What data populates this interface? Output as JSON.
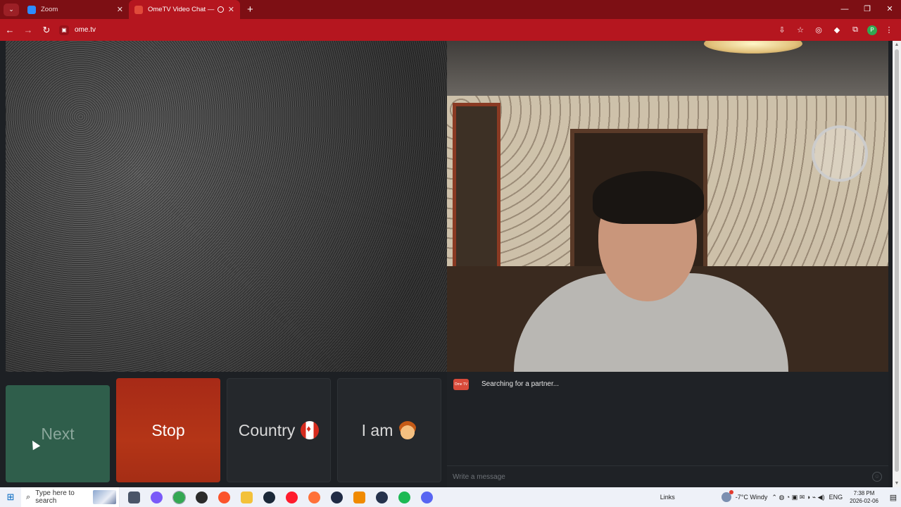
{
  "browser": {
    "tabs": [
      {
        "title": "Zoom",
        "favicon_color": "#2d8cff",
        "active": false
      },
      {
        "title": "OmeTV Video Chat — Ome",
        "favicon_color": "#e04a3a",
        "active": true
      }
    ],
    "new_tab": "+",
    "url": "ome.tv",
    "window_controls": {
      "minimize": "—",
      "restore": "❐",
      "close": "✕"
    },
    "accent": "#b5161f",
    "profile_initial": "P"
  },
  "page": {
    "controls": {
      "next_label": "Next",
      "stop_label": "Stop",
      "country_label": "Country",
      "iam_label": "I am"
    },
    "chat": {
      "logo_text": "Ome TV",
      "status": "Searching for a partner...",
      "input_placeholder": "Write a message"
    }
  },
  "taskbar": {
    "search_placeholder": "Type here to search",
    "links_label": "Links",
    "weather": "-7°C  Windy",
    "language": "ENG",
    "time": "7:38 PM",
    "date": "2026-02-06",
    "apps": [
      {
        "name": "task-view",
        "color": "#4a5568"
      },
      {
        "name": "copilot",
        "color": "#7a5af8"
      },
      {
        "name": "chrome",
        "color": "#34a853"
      },
      {
        "name": "app-dark",
        "color": "#2b2b2b"
      },
      {
        "name": "brave",
        "color": "#fb542b"
      },
      {
        "name": "file-explorer",
        "color": "#f3c13a"
      },
      {
        "name": "steam",
        "color": "#1b2838"
      },
      {
        "name": "opera",
        "color": "#ff1b2d"
      },
      {
        "name": "firefox",
        "color": "#ff7139"
      },
      {
        "name": "media-player",
        "color": "#1f2a44"
      },
      {
        "name": "vlc",
        "color": "#f08a00"
      },
      {
        "name": "arrow-app",
        "color": "#25324c"
      },
      {
        "name": "spotify",
        "color": "#1db954"
      },
      {
        "name": "discord",
        "color": "#5865f2"
      }
    ]
  }
}
